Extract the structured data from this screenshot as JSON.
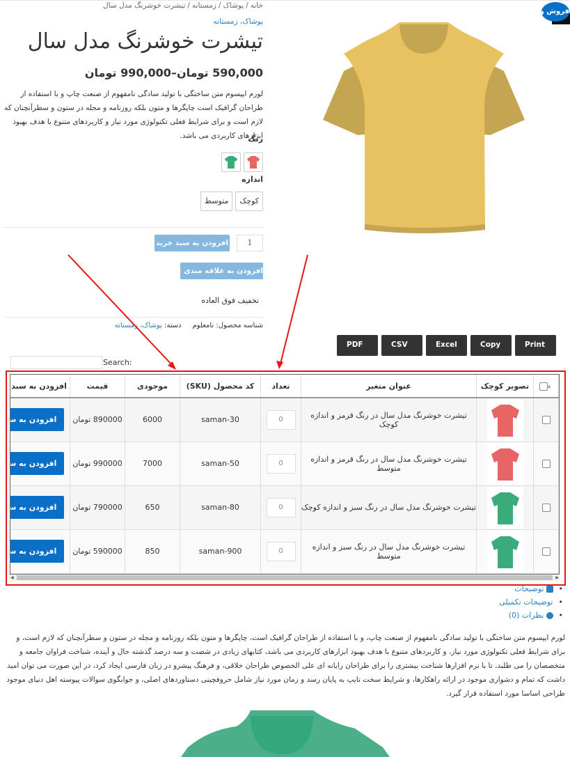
{
  "breadcrumb": [
    "خانه",
    "پوشاک",
    "زمستانه",
    "تیشرت خوشرنگ مدل سال"
  ],
  "category_link": "پوشاک، زمستانه",
  "product": {
    "title": "تیشرت خوشرنگ مدل سال",
    "price_range": "590,000 تومان–990,000 تومان",
    "short_description": "لورم ایپسوم متن ساختگی با تولید سادگی نامفهوم از صنعت چاپ و با استفاده از طراحان گرافیک است چاپگرها و متون بلکه روزنامه و مجله در ستون و سطرآنچنان که لازم است و برای شرایط فعلی تکنولوژی مورد نیاز و کاربردهای متنوع با هدف بهبود ابزارهای کاربردی می باشد.",
    "sale_badge": "فروش ویژه!",
    "main_image_color": "#e8c261"
  },
  "attributes": {
    "color_label": "رنگ",
    "colors": [
      {
        "name": "red",
        "hex": "#e86565"
      },
      {
        "name": "green",
        "hex": "#3aac7c"
      }
    ],
    "size_label": "اندازه",
    "sizes": [
      "کوچک",
      "متوسط"
    ]
  },
  "cart": {
    "quantity": "1",
    "add_to_cart_label": "افزودن به سبد خرید",
    "wishlist_label": "افزودن به علاقه مندی ها",
    "promo_text": "تخفیف فوق العاده"
  },
  "meta": {
    "sku_label": "شناسه محصول:",
    "sku_value": "نامعلوم",
    "category_label": "دسته:",
    "category_value": "پوشاک، زمستانه"
  },
  "export_buttons": [
    "PDF",
    "CSV",
    "Excel",
    "Copy",
    "Print"
  ],
  "search": {
    "label": "Search:",
    "value": ""
  },
  "variations_table": {
    "headers": [
      "",
      "تصویر کوچک",
      "عنوان متغیر",
      "تعداد",
      "کد محصول (SKU)",
      "موجودی",
      "قیمت",
      "افزودن به سبد خرید"
    ],
    "rows": [
      {
        "title": "تیشرت خوشرنگ مدل سال در رنگ قرمز و اندازه کوچک",
        "color": "#e86565",
        "qty": "0",
        "sku": "saman-30",
        "stock": "6000",
        "price": "890000 تومان",
        "cart_label": "افزودن به سبد",
        "badge": "0"
      },
      {
        "title": "تیشرت خوشرنگ مدل سال در رنگ قرمز و اندازه متوسط",
        "color": "#e86565",
        "qty": "0",
        "sku": "saman-50",
        "stock": "7000",
        "price": "990000 تومان",
        "cart_label": "افزودن به سبد",
        "badge": "0"
      },
      {
        "title": "تیشرت خوشرنگ مدل سال در رنگ سبز و اندازه کوچک",
        "color": "#3aac7c",
        "qty": "0",
        "sku": "saman-80",
        "stock": "650",
        "price": "790000 تومان",
        "cart_label": "افزودن به سبد",
        "badge": "0"
      },
      {
        "title": "تیشرت خوشرنگ مدل سال در رنگ سبز و اندازه متوسط",
        "color": "#3aac7c",
        "qty": "0",
        "sku": "saman-900",
        "stock": "850",
        "price": "590000 تومان",
        "cart_label": "افزودن به سبد",
        "badge": "0"
      }
    ]
  },
  "tabs": [
    {
      "label": "توضیحات",
      "icon": "document-icon"
    },
    {
      "label": "توضیحات تکمیلی",
      "icon": ""
    },
    {
      "label": "نظرات (0)",
      "icon": "chat-icon"
    }
  ],
  "long_description": "لورم ایپسوم متن ساختگی با تولید سادگی نامفهوم از صنعت چاپ، و با استفاده از طراحان گرافیک است، چاپگرها و متون بلکه روزنامه و مجله در ستون و سطرآنچنان که لازم است، و برای شرایط فعلی تکنولوژی مورد نیاز، و کاربردهای متنوع با هدف بهبود ابزارهای کاربردی می باشد، کتابهای زیادی در شصت و سه درصد گذشته حال و آینده، شناخت فراوان جامعه و متخصصان را می طلبد، تا با نرم افزارها شناخت بیشتری را برای طراحان رایانه ای علی الخصوص طراحان خلاقی، و فرهنگ پیشرو در زبان فارسی ایجاد کرد، در این صورت می توان امید داشت که تمام و دشواری موجود در ارائه راهکارها، و شرایط سخت تایپ به پایان رسد و زمان مورد نیاز شامل حروفچینی دستاوردهای اصلی، و جوابگوی سوالات پیوسته اهل دنیای موجود طراحی اساسا مورد استفاده قرار گیرد.",
  "bottom_image_color": "#4bb08a",
  "colors": {
    "link": "#2a7fc1",
    "primary_button": "#0a70c7",
    "disabled_button": "#84b8e0",
    "export_button": "#333333",
    "annotation": "#e81515",
    "badge": "#e8384f"
  }
}
